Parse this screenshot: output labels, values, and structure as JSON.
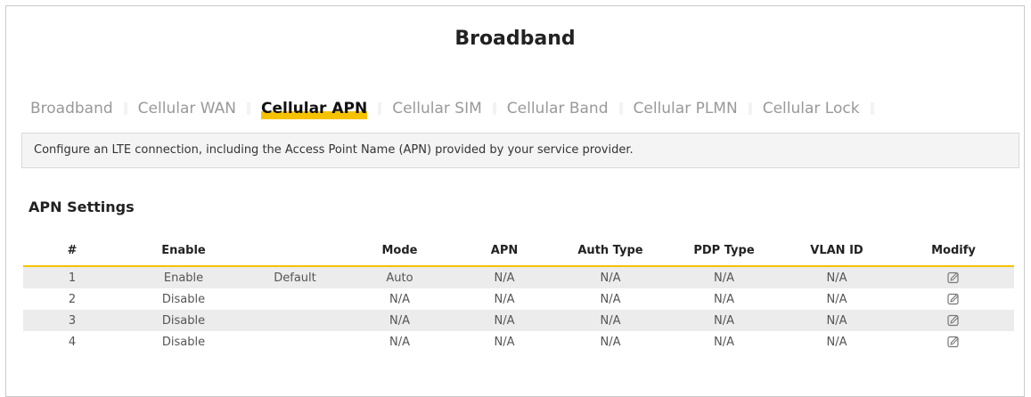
{
  "page": {
    "title": "Broadband"
  },
  "tabs": [
    {
      "label": "Broadband",
      "active": false
    },
    {
      "label": "Cellular WAN",
      "active": false
    },
    {
      "label": "Cellular APN",
      "active": true
    },
    {
      "label": "Cellular SIM",
      "active": false
    },
    {
      "label": "Cellular Band",
      "active": false
    },
    {
      "label": "Cellular PLMN",
      "active": false
    },
    {
      "label": "Cellular Lock",
      "active": false
    }
  ],
  "info": {
    "text": "Configure an LTE connection, including the Access Point Name (APN) provided by your service provider."
  },
  "apn_settings": {
    "title": "APN Settings",
    "columns": [
      "#",
      "Enable",
      "",
      "Mode",
      "APN",
      "Auth Type",
      "PDP Type",
      "VLAN ID",
      "Modify"
    ],
    "rows": [
      [
        "1",
        "Enable",
        "Default",
        "Auto",
        "N/A",
        "N/A",
        "N/A",
        "N/A",
        ""
      ],
      [
        "2",
        "Disable",
        "",
        "N/A",
        "N/A",
        "N/A",
        "N/A",
        "N/A",
        ""
      ],
      [
        "3",
        "Disable",
        "",
        "N/A",
        "N/A",
        "N/A",
        "N/A",
        "N/A",
        ""
      ],
      [
        "4",
        "Disable",
        "",
        "N/A",
        "N/A",
        "N/A",
        "N/A",
        "N/A",
        ""
      ]
    ],
    "modify_icon": "edit-icon"
  },
  "colors": {
    "accent": "#f6c200",
    "row_shade": "#ececec",
    "info_bg": "#f4f4f4"
  }
}
